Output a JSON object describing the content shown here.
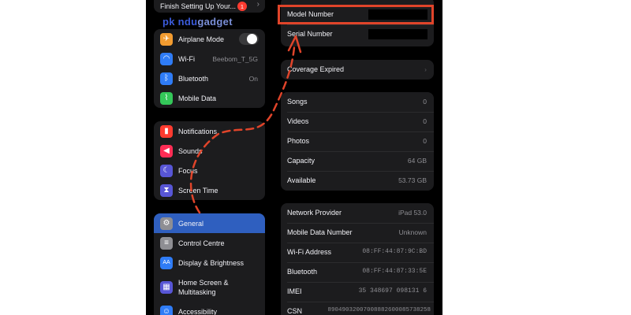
{
  "watermark": {
    "part1": "pk ndu",
    "part2": "gadget"
  },
  "left": {
    "setup": {
      "label": "Finish Setting Up Your...",
      "badge": "1"
    },
    "group1": [
      {
        "icon": "airplane-icon",
        "color": "#f39c30",
        "label": "Airplane Mode",
        "value": "",
        "toggle": true
      },
      {
        "icon": "wifi-icon",
        "color": "#2f7cf6",
        "label": "Wi-Fi",
        "value": "Beebom_T_5G"
      },
      {
        "icon": "bluetooth-icon",
        "color": "#2f7cf6",
        "label": "Bluetooth",
        "value": "On"
      },
      {
        "icon": "antenna-icon",
        "color": "#34c759",
        "label": "Mobile Data",
        "value": ""
      }
    ],
    "group2": [
      {
        "icon": "bell-icon",
        "color": "#ff3b30",
        "label": "Notifications"
      },
      {
        "icon": "speaker-icon",
        "color": "#ff2d55",
        "label": "Sounds"
      },
      {
        "icon": "moon-icon",
        "color": "#5856d6",
        "label": "Focus"
      },
      {
        "icon": "hourglass-icon",
        "color": "#5856d6",
        "label": "Screen Time"
      }
    ],
    "group3": [
      {
        "icon": "gear-icon",
        "color": "#8e8e93",
        "label": "General",
        "selected": true
      },
      {
        "icon": "switches-icon",
        "color": "#8e8e93",
        "label": "Control Centre"
      },
      {
        "icon": "text-size-icon",
        "color": "#2f7cf6",
        "label": "Display & Brightness"
      },
      {
        "icon": "grid-icon",
        "color": "#5856d6",
        "label": "Home Screen & Multitasking"
      },
      {
        "icon": "accessibility-icon",
        "color": "#2f7cf6",
        "label": "Accessibility"
      }
    ]
  },
  "right": {
    "top": [
      {
        "label": "Model Number",
        "value": ""
      },
      {
        "label": "Serial Number",
        "value": ""
      }
    ],
    "coverage": {
      "label": "Coverage Expired"
    },
    "media": [
      {
        "label": "Songs",
        "value": "0"
      },
      {
        "label": "Videos",
        "value": "0"
      },
      {
        "label": "Photos",
        "value": "0"
      },
      {
        "label": "Capacity",
        "value": "64 GB"
      },
      {
        "label": "Available",
        "value": "53.73 GB"
      }
    ],
    "network": [
      {
        "label": "Network Provider",
        "value": "iPad 53.0"
      },
      {
        "label": "Mobile Data Number",
        "value": "Unknown"
      },
      {
        "label": "Wi-Fi Address",
        "value": "08:FF:44:87:9C:BD"
      },
      {
        "label": "Bluetooth",
        "value": "08:FF:44:87:33:5E"
      },
      {
        "label": "IMEI",
        "value": "35 348697 098131 6"
      },
      {
        "label": "CSN",
        "value": "89049032007008882600085738258"
      }
    ]
  },
  "colors": {
    "highlight": "#e0442a",
    "selected": "#2f5fbf"
  }
}
